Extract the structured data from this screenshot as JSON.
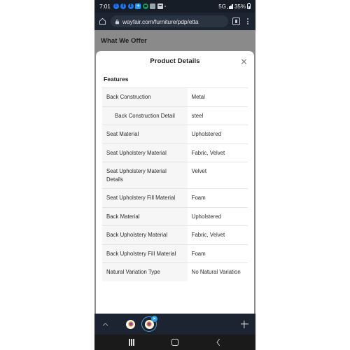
{
  "status_bar": {
    "clock": "7:01",
    "network": "5G",
    "battery_percent": "35%",
    "icons": [
      "facebook-icon",
      "facebook-icon",
      "facebook-icon",
      "plus-app-icon",
      "messenger-icon",
      "camera-icon",
      "mail-icon",
      "more-dot-icon"
    ]
  },
  "browser": {
    "home_icon": "home-icon",
    "lock_icon": "lock-icon",
    "url": "wayfair.com/furniture/pdp/etta",
    "tab_count_icon": "tab-count-icon",
    "overflow_icon": "overflow-menu-icon"
  },
  "page": {
    "section_behind": "What We Offer",
    "scrim_color": "#8b8b8b"
  },
  "modal": {
    "title": "Product Details",
    "close_label": "×",
    "section_heading": "Features",
    "rows": [
      {
        "label": "Back Construction",
        "value": "Metal",
        "indent": false
      },
      {
        "label": "Back Construction Detail",
        "value": "steel",
        "indent": true
      },
      {
        "label": "Seat Material",
        "value": "Upholstered",
        "indent": false
      },
      {
        "label": "Seat Upholstery Material",
        "value": "Fabric, Velvet",
        "indent": false
      },
      {
        "label": "Seat Upholstery Material Details",
        "value": "Velvet",
        "indent": false
      },
      {
        "label": "Seat Upholstery Fill Material",
        "value": "Foam",
        "indent": false
      },
      {
        "label": "Back Material",
        "value": "Upholstered",
        "indent": false
      },
      {
        "label": "Back Upholstery Material",
        "value": "Fabric, Velvet",
        "indent": false
      },
      {
        "label": "Back Upholstery Fill Material",
        "value": "Foam",
        "indent": false
      },
      {
        "label": "Natural Variation Type",
        "value": "No Natural Variation",
        "indent": false
      }
    ]
  },
  "tab_strip": {
    "chevron_icon": "chevron-up-icon",
    "tabs": [
      {
        "name": "tab-favicon-1",
        "selected": false
      },
      {
        "name": "tab-favicon-2",
        "selected": true,
        "close_label": "×"
      }
    ],
    "new_tab_icon": "plus-icon"
  },
  "nav_bar": {
    "recents_icon": "recents-icon",
    "home_icon": "home-square-icon",
    "back_icon": "back-chevron-icon"
  },
  "colors": {
    "chrome_dark": "#1b2430",
    "status_dark": "#161d27",
    "omnibox": "#2a3340",
    "accent_blue": "#2d9cdb",
    "sheet_white": "#ffffff",
    "row_key_bg": "#f6f6f6",
    "divider": "#e4e4e4",
    "nav_bar": "#1a1a1a"
  }
}
